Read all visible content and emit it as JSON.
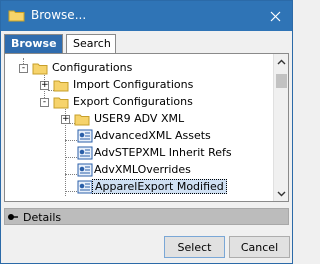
{
  "window": {
    "title": "Browse...",
    "icon": "window-folder-icon",
    "close_icon": "close-icon"
  },
  "tabs": [
    {
      "label": "Browse",
      "active": true
    },
    {
      "label": "Search",
      "active": false
    }
  ],
  "tree": {
    "items": [
      {
        "label": "Configurations",
        "icon": "folder-icon",
        "expander": "-"
      },
      {
        "label": "Import Configurations",
        "icon": "folder-icon",
        "expander": "+"
      },
      {
        "label": "Export Configurations",
        "icon": "folder-icon",
        "expander": "-"
      },
      {
        "label": "USER9 ADV XML",
        "icon": "folder-icon",
        "expander": "+"
      },
      {
        "label": "AdvancedXML Assets",
        "icon": "export-config-icon"
      },
      {
        "label": "AdvSTEPXML Inherit Refs",
        "icon": "export-config-icon"
      },
      {
        "label": "AdvXMLOverrides",
        "icon": "export-config-icon"
      },
      {
        "label": "ApparelExport Modified",
        "icon": "export-config-icon",
        "selected": true
      }
    ]
  },
  "details": {
    "label": "Details",
    "icon": "expand-details-icon"
  },
  "buttons": {
    "select": "Select",
    "cancel": "Cancel"
  },
  "colors": {
    "titlebar": "#2f74b6",
    "active_tab": "#2f6cae",
    "selection": "#cfe0f3",
    "details_bar": "#bcbcbc"
  }
}
